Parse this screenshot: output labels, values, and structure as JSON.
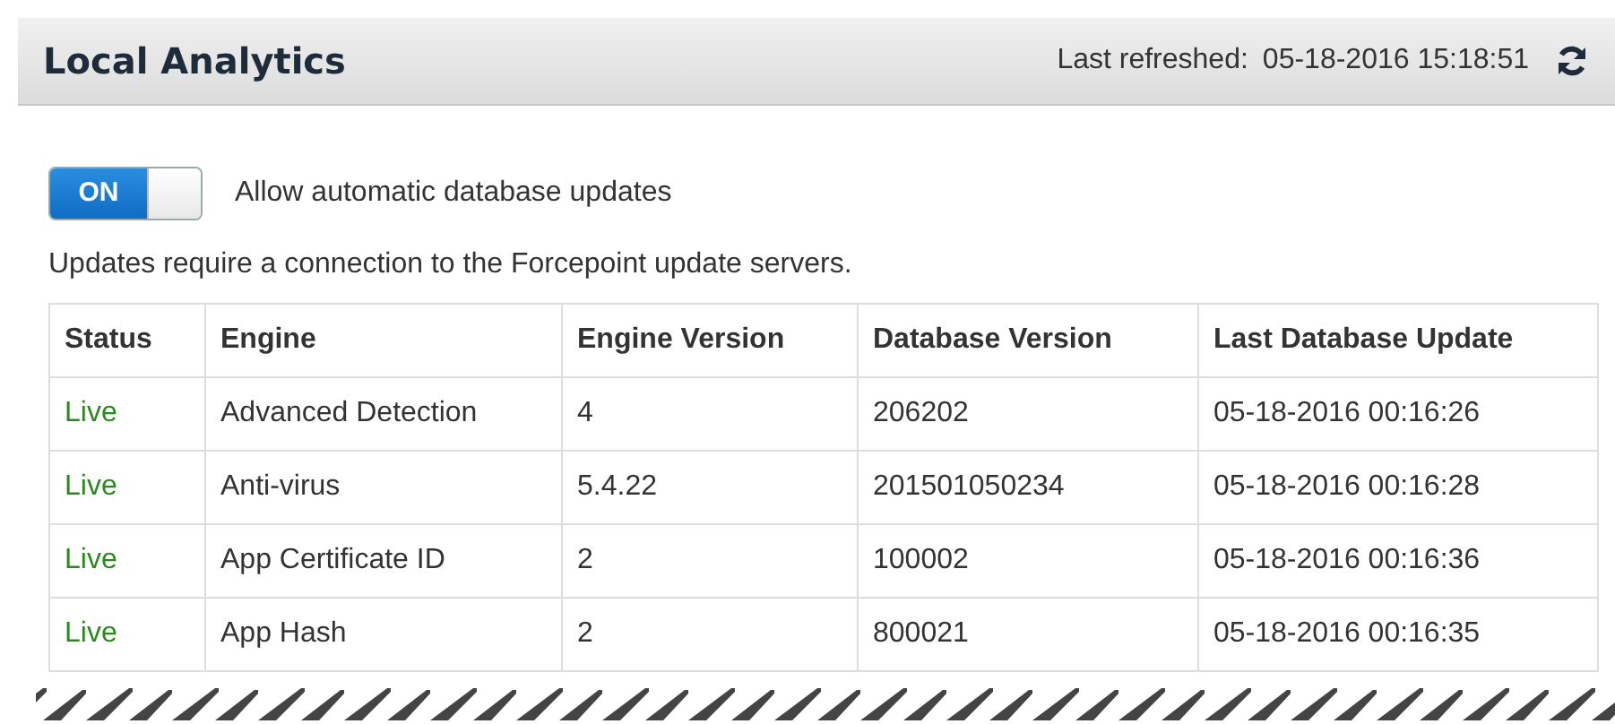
{
  "header": {
    "title": "Local Analytics",
    "refreshed_label": "Last refreshed:",
    "refreshed_value": "05-18-2016 15:18:51"
  },
  "auto_update": {
    "on": true,
    "on_label": "ON",
    "label": "Allow automatic database updates"
  },
  "note": "Updates require a connection to the Forcepoint update servers.",
  "table": {
    "columns": [
      "Status",
      "Engine",
      "Engine Version",
      "Database Version",
      "Last Database Update"
    ],
    "rows": [
      [
        "Live",
        "Advanced Detection",
        "4",
        "206202",
        "05-18-2016 00:16:26"
      ],
      [
        "Live",
        "Anti-virus",
        "5.4.22",
        "201501050234",
        "05-18-2016 00:16:28"
      ],
      [
        "Live",
        "App Certificate ID",
        "2",
        "100002",
        "05-18-2016 00:16:36"
      ],
      [
        "Live",
        "App Hash",
        "2",
        "800021",
        "05-18-2016 00:16:35"
      ]
    ]
  }
}
